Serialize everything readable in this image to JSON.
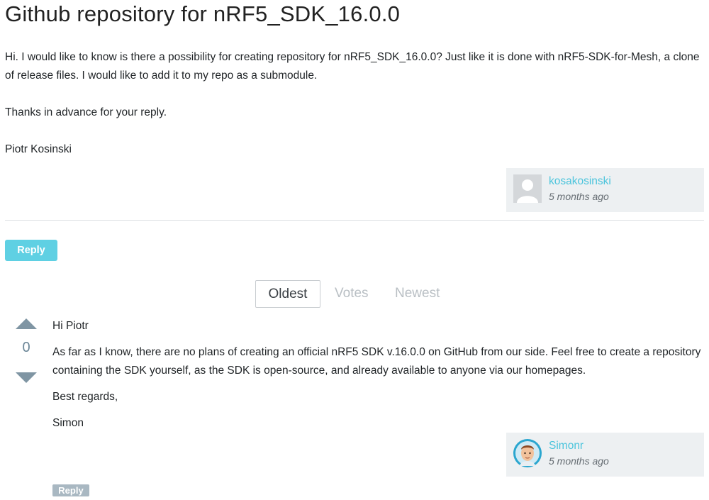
{
  "question": {
    "title": "Github repository for nRF5_SDK_16.0.0",
    "paragraphs": [
      "Hi. I would like to know is there a possibility for creating repository for nRF5_SDK_16.0.0? Just like it is done with nRF5-SDK-for-Mesh, a clone of release files. I would like to add it to my repo as a submodule.",
      "Thanks in advance for your reply.",
      "Piotr Kosinski"
    ],
    "author": {
      "name": "kosakosinski",
      "time": "5 months ago",
      "avatar_icon": "default-user-avatar-icon"
    }
  },
  "reply_label": "Reply",
  "sort_tabs": [
    "Oldest",
    "Votes",
    "Newest"
  ],
  "sort_active": "Oldest",
  "answer": {
    "votes": "0",
    "paragraphs": [
      "Hi Piotr",
      "As far as I know, there are no plans of creating an official nRF5 SDK v.16.0.0 on GitHub from our side. Feel free to create a repository containing the SDK yourself, as the SDK is open-source, and already available to anyone via our homepages.",
      "Best regards,",
      "Simon"
    ],
    "author": {
      "name": "Simonr",
      "time": "5 months ago",
      "avatar_icon": "user-photo-avatar-icon"
    },
    "reply_label": "Reply"
  },
  "colors": {
    "accent": "#5fd0e3",
    "link": "#4bc4dc",
    "card_bg": "#edf0f2",
    "vote_arrow": "#7f95a3"
  }
}
